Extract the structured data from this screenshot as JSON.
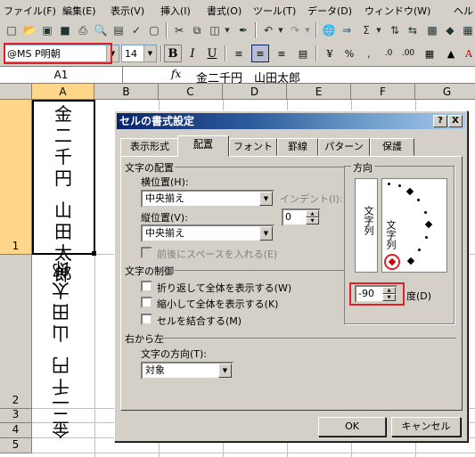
{
  "menu": [
    "ファイル(F)",
    "編集(E)",
    "表示(V)",
    "挿入(I)",
    "書式(O)",
    "ツール(T)",
    "データ(D)",
    "ウィンドウ(W)",
    "ヘル"
  ],
  "toolbar": {
    "font_name": "@MS P明朝",
    "font_size": "14",
    "bold": "B",
    "italic": "I",
    "underline": "U",
    "sigma": "Σ"
  },
  "formula_bar": {
    "name_box": "A1",
    "fx": "fx",
    "content": "金二千円　山田太郎"
  },
  "sheet": {
    "columns": [
      "A",
      "B",
      "C",
      "D",
      "E",
      "F",
      "G"
    ],
    "rows": [
      "1",
      "2",
      "3",
      "4",
      "5"
    ],
    "cell_a1_chars": [
      "金",
      "二",
      "千",
      "円",
      "",
      "山",
      "田",
      "太",
      "郎"
    ],
    "cell_a2_chars": [
      "郎",
      "太",
      "田",
      "山",
      "",
      "円",
      "千",
      "二",
      "金"
    ]
  },
  "dialog": {
    "title": "セルの書式設定",
    "help_btn": "?",
    "close_btn": "X",
    "tabs": [
      "表示形式",
      "配置",
      "フォント",
      "罫線",
      "パターン",
      "保護"
    ],
    "text_alignment_group": "文字の配置",
    "horizontal_label": "横位置(H):",
    "horizontal_value": "中央揃え",
    "indent_label": "インデント(I):",
    "indent_value": "0",
    "vertical_label": "縦位置(V):",
    "vertical_value": "中央揃え",
    "distribute_label": "前後にスペースを入れる(E)",
    "text_control_group": "文字の制御",
    "wrap_label": "折り返して全体を表示する(W)",
    "shrink_label": "縮小して全体を表示する(K)",
    "merge_label": "セルを結合する(M)",
    "rtl_group": "右から左",
    "direction_label": "文字の方向(T):",
    "direction_value": "対象",
    "orientation_group": "方向",
    "vertical_text": "文字列",
    "rotated_text": "文字列",
    "degrees_value": "-90",
    "degrees_label": "度(D)",
    "ok": "OK",
    "cancel": "キャンセル"
  }
}
